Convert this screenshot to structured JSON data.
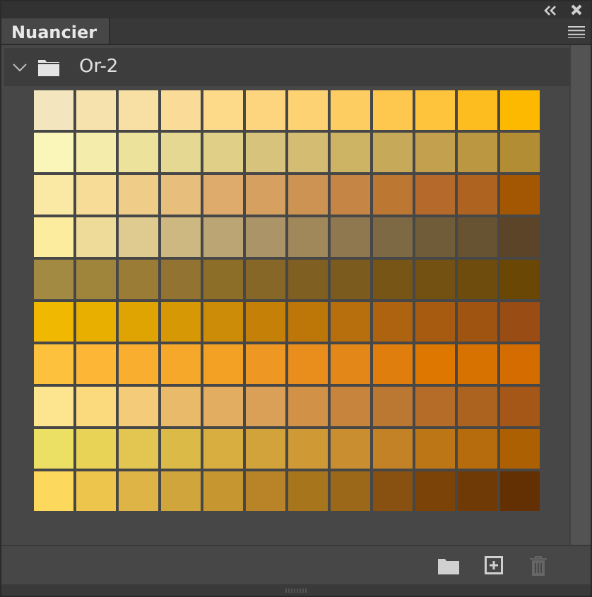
{
  "panel": {
    "tab": {
      "label": "Nuancier",
      "selected": true
    }
  },
  "group": {
    "name": "Or-2",
    "expanded": true,
    "swatches": [
      {
        "color": "#f3e5bd"
      },
      {
        "color": "#f6e2ad"
      },
      {
        "color": "#f8e0a4"
      },
      {
        "color": "#fadc98"
      },
      {
        "color": "#fdd98a"
      },
      {
        "color": "#fdd57f"
      },
      {
        "color": "#fdd272"
      },
      {
        "color": "#fecd62"
      },
      {
        "color": "#fec84f"
      },
      {
        "color": "#fec53c"
      },
      {
        "color": "#fdbd1f"
      },
      {
        "color": "#fdb900"
      },
      {
        "color": "#faf5b8"
      },
      {
        "color": "#f3ecaa"
      },
      {
        "color": "#ece29c"
      },
      {
        "color": "#e4d893"
      },
      {
        "color": "#e0cf86"
      },
      {
        "color": "#d8c37c"
      },
      {
        "color": "#d4bd72"
      },
      {
        "color": "#cdb465"
      },
      {
        "color": "#c7a95a"
      },
      {
        "color": "#c2a04e"
      },
      {
        "color": "#bb9741"
      },
      {
        "color": "#b28d33"
      },
      {
        "color": "#fae8a5"
      },
      {
        "color": "#f6dc97"
      },
      {
        "color": "#f0cc89"
      },
      {
        "color": "#e8be7d"
      },
      {
        "color": "#deab6c"
      },
      {
        "color": "#d6a061"
      },
      {
        "color": "#cd9353"
      },
      {
        "color": "#c58545"
      },
      {
        "color": "#bc7732"
      },
      {
        "color": "#b5692a"
      },
      {
        "color": "#ae6420"
      },
      {
        "color": "#a35702"
      },
      {
        "color": "#fcec9e"
      },
      {
        "color": "#eedb99"
      },
      {
        "color": "#dfcb90"
      },
      {
        "color": "#cdb882"
      },
      {
        "color": "#bca574"
      },
      {
        "color": "#ab9568"
      },
      {
        "color": "#a0885a"
      },
      {
        "color": "#8f784f"
      },
      {
        "color": "#7d6944"
      },
      {
        "color": "#705c39"
      },
      {
        "color": "#675232"
      },
      {
        "color": "#5b4428"
      },
      {
        "color": "#a28a42"
      },
      {
        "color": "#9f853c"
      },
      {
        "color": "#9a7c36"
      },
      {
        "color": "#937332"
      },
      {
        "color": "#8c6e29"
      },
      {
        "color": "#866727"
      },
      {
        "color": "#805f22"
      },
      {
        "color": "#7b5b1e"
      },
      {
        "color": "#775516"
      },
      {
        "color": "#735113"
      },
      {
        "color": "#6e4c0d"
      },
      {
        "color": "#6a4704"
      },
      {
        "color": "#f0b800"
      },
      {
        "color": "#e9af00"
      },
      {
        "color": "#dfa302"
      },
      {
        "color": "#d69804"
      },
      {
        "color": "#cd8c07"
      },
      {
        "color": "#c58107"
      },
      {
        "color": "#bd7709"
      },
      {
        "color": "#b76e0d"
      },
      {
        "color": "#ad630f"
      },
      {
        "color": "#a65b11"
      },
      {
        "color": "#a05411"
      },
      {
        "color": "#994c13"
      },
      {
        "color": "#fec13d"
      },
      {
        "color": "#fdb635"
      },
      {
        "color": "#f9ae30"
      },
      {
        "color": "#f6a82a"
      },
      {
        "color": "#f3a124"
      },
      {
        "color": "#ee9722"
      },
      {
        "color": "#e98e1c"
      },
      {
        "color": "#e38818"
      },
      {
        "color": "#df7e0c"
      },
      {
        "color": "#dd7700"
      },
      {
        "color": "#d77100"
      },
      {
        "color": "#d56c00"
      },
      {
        "color": "#fde58f"
      },
      {
        "color": "#fbd97d"
      },
      {
        "color": "#f4cb78"
      },
      {
        "color": "#eaba6b"
      },
      {
        "color": "#e3ad61"
      },
      {
        "color": "#daa057"
      },
      {
        "color": "#d19248"
      },
      {
        "color": "#c7843d"
      },
      {
        "color": "#bb7832"
      },
      {
        "color": "#b46c28"
      },
      {
        "color": "#ac6320"
      },
      {
        "color": "#a45716"
      },
      {
        "color": "#ebe063"
      },
      {
        "color": "#e8d356"
      },
      {
        "color": "#e3c652"
      },
      {
        "color": "#dbba48"
      },
      {
        "color": "#d9ae41"
      },
      {
        "color": "#d2a33b"
      },
      {
        "color": "#cf9935"
      },
      {
        "color": "#c98e2f"
      },
      {
        "color": "#c48227"
      },
      {
        "color": "#bc7616"
      },
      {
        "color": "#b66c0c"
      },
      {
        "color": "#ad6001"
      },
      {
        "color": "#fcd85c"
      },
      {
        "color": "#edc44c"
      },
      {
        "color": "#ddb445"
      },
      {
        "color": "#d0a53b"
      },
      {
        "color": "#c69631"
      },
      {
        "color": "#b98428"
      },
      {
        "color": "#a7761c"
      },
      {
        "color": "#9a6818"
      },
      {
        "color": "#885111"
      },
      {
        "color": "#7c4308"
      },
      {
        "color": "#703a06"
      },
      {
        "color": "#633003"
      }
    ]
  },
  "toolbar": {
    "buttons": [
      {
        "kind": "folder",
        "disabled": false
      },
      {
        "kind": "new",
        "disabled": false
      },
      {
        "kind": "trash",
        "disabled": true
      }
    ]
  }
}
